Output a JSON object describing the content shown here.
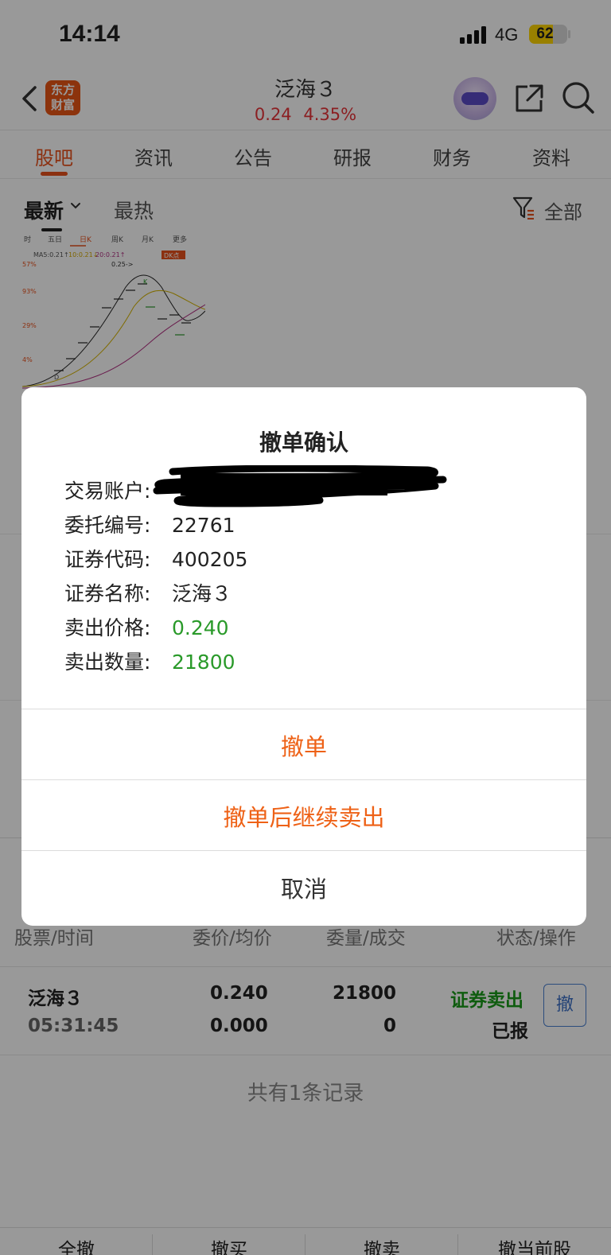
{
  "status_bar": {
    "time": "14:14",
    "network": "4G",
    "battery": "62",
    "battery_level": 0.62
  },
  "header": {
    "logo_line1": "东方",
    "logo_line2": "财富",
    "title": "泛海３",
    "price": "0.24",
    "change_pct": "4.35%"
  },
  "tabs": [
    "股吧",
    "资讯",
    "公告",
    "研报",
    "财务",
    "资料"
  ],
  "sort": {
    "newest": "最新",
    "hottest": "最热",
    "filter_all": "全部"
  },
  "thumbnail": {
    "periods": [
      "时",
      "五日",
      "日K",
      "周K",
      "月K",
      "更多"
    ],
    "ma_line": "MA5:0.21↑",
    "ma10": "10:0.21↓",
    "ma20": "20:0.21↑",
    "dk": "DK点",
    "arrow_note": "0.25->",
    "y_labels": [
      "57%",
      "93%",
      "29%",
      "4%"
    ]
  },
  "dialog": {
    "title": "撤单确认",
    "fields": [
      {
        "key": "交易账户:",
        "value": ""
      },
      {
        "key": "委托编号:",
        "value": "22761"
      },
      {
        "key": "证券代码:",
        "value": "400205"
      },
      {
        "key": "证券名称:",
        "value": "泛海３"
      },
      {
        "key": "卖出价格:",
        "value": "0.240"
      },
      {
        "key": "卖出数量:",
        "value": "21800"
      }
    ],
    "btn_cancel_order": "撤单",
    "btn_cancel_and_sell": "撤单后继续卖出",
    "btn_dismiss": "取消"
  },
  "orders": {
    "headers": [
      "股票/时间",
      "委价/均价",
      "委量/成交",
      "状态/操作"
    ],
    "rows": [
      {
        "name": "泛海３",
        "time": "05:31:45",
        "price": "0.240",
        "avg_price": "0.000",
        "qty": "21800",
        "filled": "0",
        "direction": "证券卖出",
        "status": "已报",
        "action": "撤"
      }
    ],
    "summary": "共有1条记录"
  },
  "bottom_bar": [
    "全撤",
    "撤买",
    "撤卖",
    "撤当前股"
  ],
  "colors": {
    "accent": "#e8501b",
    "up_red": "#e8343a",
    "sell_green": "#2a9a2a",
    "link_blue": "#3b6fc5"
  }
}
